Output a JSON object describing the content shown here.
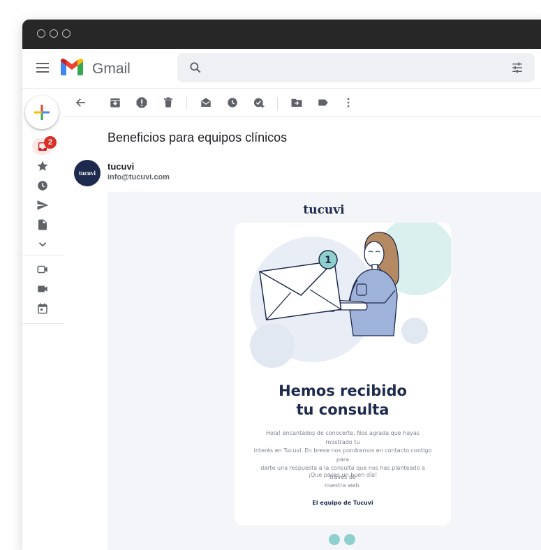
{
  "app": {
    "logo_text": "Gmail",
    "search_placeholder": ""
  },
  "sidebar": {
    "inbox_badge": "2",
    "items": [
      {
        "icon": "inbox-icon"
      },
      {
        "icon": "star-icon"
      },
      {
        "icon": "clock-icon"
      },
      {
        "icon": "send-icon"
      },
      {
        "icon": "draft-icon"
      },
      {
        "icon": "chevron-down-icon"
      },
      {
        "icon": "video-outline-icon"
      },
      {
        "icon": "video-icon"
      },
      {
        "icon": "calendar-icon"
      }
    ]
  },
  "toolbar": {
    "icons": [
      "back-arrow-icon",
      "archive-icon",
      "report-spam-icon",
      "delete-icon",
      "mark-unread-icon",
      "snooze-icon",
      "add-task-icon",
      "move-to-icon",
      "label-icon",
      "more-vert-icon"
    ]
  },
  "email": {
    "subject": "Beneficios para equipos clínicos",
    "sender_name": "tucuvi",
    "sender_email": "info@tucuvi.com",
    "avatar_text": "tucuvi",
    "body": {
      "brand": "tucuvi",
      "badge_number": "1",
      "headline_line1": "Hemos recibido",
      "headline_line2": "tu consulta",
      "paragraph_line1": "Hola! encantados de conocerte. Nos agrada que hayas mostrado tu",
      "paragraph_line2": "interés en Tucuvi. En breve nos pondremos en contacto contigo para",
      "paragraph_line3": "darte una respuesta a la consulta que nos has planteado a través de",
      "paragraph_line4": "nuestra web.",
      "wish": "¡Que pases un buen día!",
      "signature": "El equipo de Tucuvi"
    }
  },
  "colors": {
    "titlebar": "#272727",
    "brand_navy": "#1d2a4d",
    "accent_teal": "#8fd0cf",
    "badge_red": "#d93025",
    "email_bg": "#f4f5f8"
  }
}
